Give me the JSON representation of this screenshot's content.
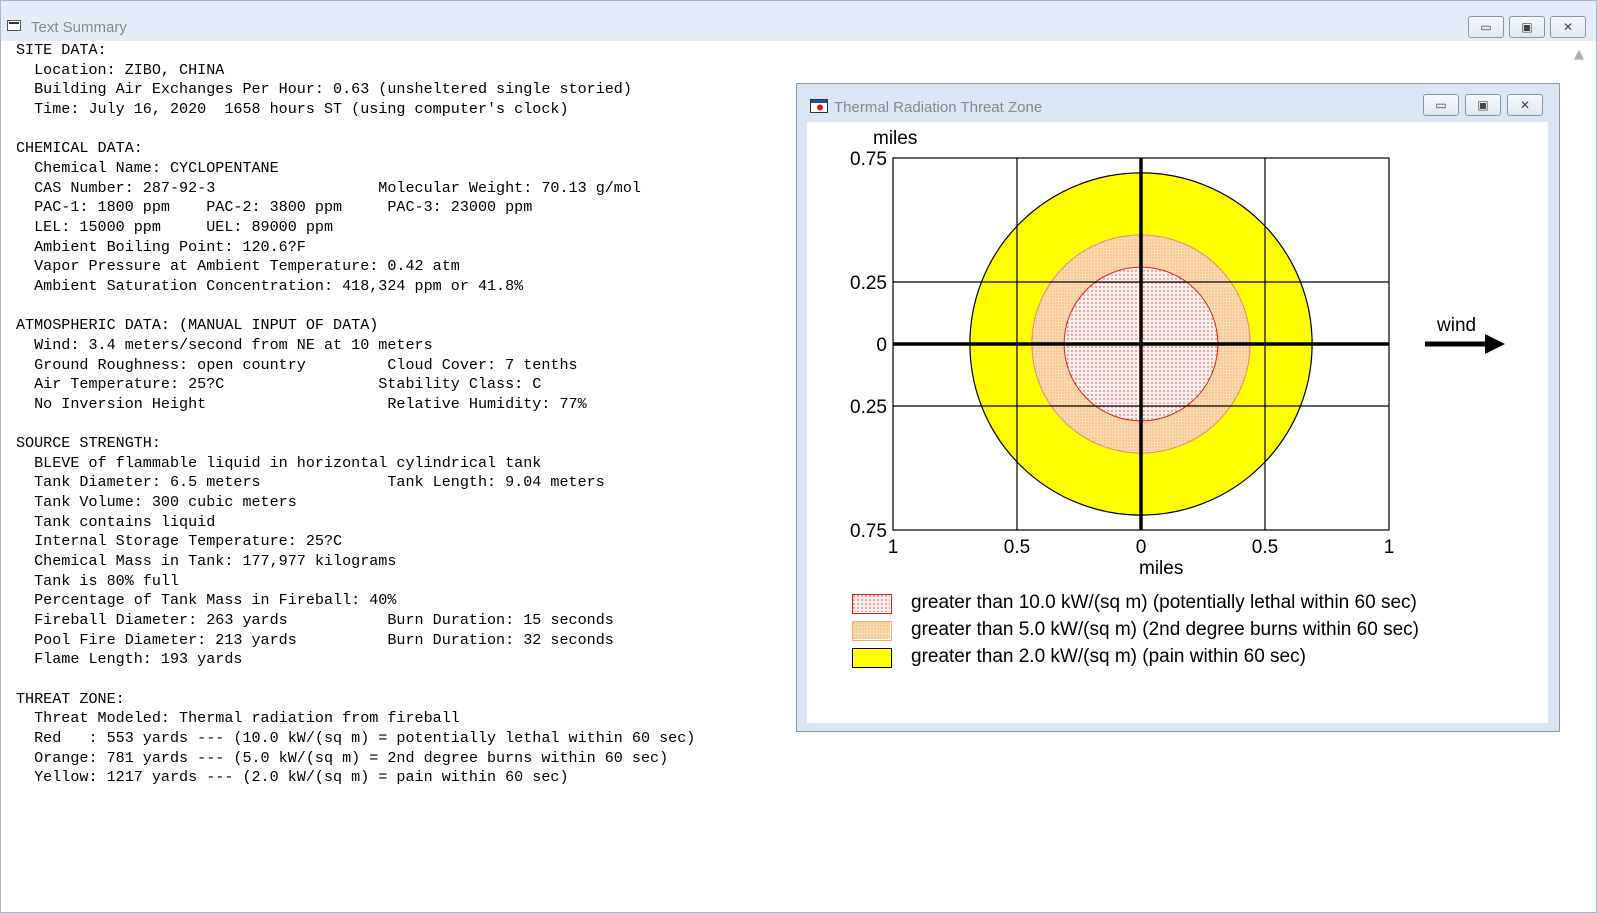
{
  "main_window": {
    "title": "Text Summary",
    "controls": {
      "minimize": "▭",
      "maximize": "▣",
      "close": "✕"
    },
    "summary_lines": [
      "SITE DATA:",
      "  Location: ZIBO, CHINA",
      "  Building Air Exchanges Per Hour: 0.63 (unsheltered single storied)",
      "  Time: July 16, 2020  1658 hours ST (using computer's clock)",
      "",
      "CHEMICAL DATA:",
      "  Chemical Name: CYCLOPENTANE",
      "  CAS Number: 287-92-3                  Molecular Weight: 70.13 g/mol",
      "  PAC-1: 1800 ppm    PAC-2: 3800 ppm     PAC-3: 23000 ppm",
      "  LEL: 15000 ppm     UEL: 89000 ppm",
      "  Ambient Boiling Point: 120.6?F",
      "  Vapor Pressure at Ambient Temperature: 0.42 atm",
      "  Ambient Saturation Concentration: 418,324 ppm or 41.8%",
      "",
      "ATMOSPHERIC DATA: (MANUAL INPUT OF DATA)",
      "  Wind: 3.4 meters/second from NE at 10 meters",
      "  Ground Roughness: open country         Cloud Cover: 7 tenths",
      "  Air Temperature: 25?C                 Stability Class: C",
      "  No Inversion Height                    Relative Humidity: 77%",
      "",
      "SOURCE STRENGTH:",
      "  BLEVE of flammable liquid in horizontal cylindrical tank",
      "  Tank Diameter: 6.5 meters              Tank Length: 9.04 meters",
      "  Tank Volume: 300 cubic meters",
      "  Tank contains liquid",
      "  Internal Storage Temperature: 25?C",
      "  Chemical Mass in Tank: 177,977 kilograms",
      "  Tank is 80% full",
      "  Percentage of Tank Mass in Fireball: 40%",
      "  Fireball Diameter: 263 yards           Burn Duration: 15 seconds",
      "  Pool Fire Diameter: 213 yards          Burn Duration: 32 seconds",
      "  Flame Length: 193 yards",
      "",
      "THREAT ZONE:",
      "  Threat Modeled: Thermal radiation from fireball",
      "  Red   : 553 yards --- (10.0 kW/(sq m) = potentially lethal within 60 sec)",
      "  Orange: 781 yards --- (5.0 kW/(sq m) = 2nd degree burns within 60 sec)",
      "  Yellow: 1217 yards --- (2.0 kW/(sq m) = pain within 60 sec)"
    ]
  },
  "plot_window": {
    "title": "Thermal Radiation Threat Zone",
    "wind_label": "wind",
    "y_axis_label": "miles",
    "x_axis_label": "miles",
    "y_ticks": [
      "0.75",
      "0.25",
      "0",
      "0.25",
      "0.75"
    ],
    "x_ticks": [
      "1",
      "0.5",
      "0",
      "0.5",
      "1"
    ],
    "legend": [
      {
        "label": "greater than 10.0 kW/(sq m) (potentially lethal within 60 sec)",
        "color": "#ff2020"
      },
      {
        "label": "greater than 5.0 kW/(sq m) (2nd degree burns within 60 sec)",
        "color": "#f5c896"
      },
      {
        "label": "greater than 2.0 kW/(sq m) (pain within 60 sec)",
        "color": "#ffff00"
      }
    ]
  },
  "chart_data": {
    "type": "scatter",
    "x_range_miles": [
      -1,
      1
    ],
    "y_range_miles": [
      -0.75,
      0.75
    ],
    "zones": [
      {
        "name": "yellow",
        "radius_miles": 0.69,
        "color": "#ffff00"
      },
      {
        "name": "orange",
        "radius_miles": 0.44,
        "color": "#f5c896"
      },
      {
        "name": "red",
        "radius_miles": 0.31,
        "color": "#ff2020"
      }
    ],
    "grid": true
  }
}
